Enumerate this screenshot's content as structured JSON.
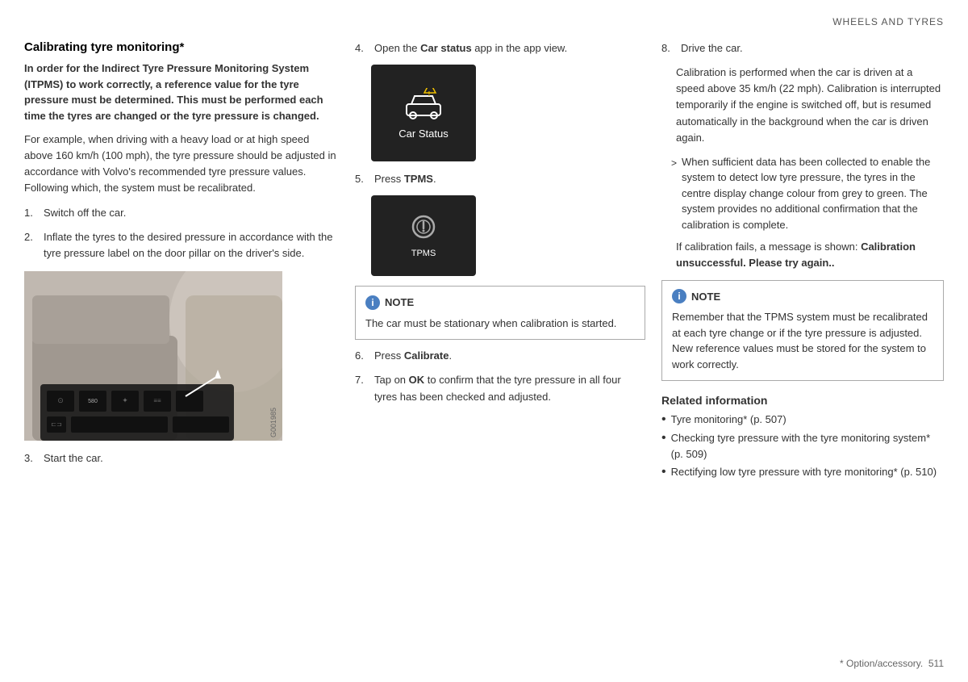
{
  "header": {
    "section_title": "WHEELS AND TYRES"
  },
  "left_col": {
    "title": "Calibrating tyre monitoring*",
    "intro_bold": "In order for the Indirect Tyre Pressure Monitoring System (ITPMS) to work correctly, a reference value for the tyre pressure must be determined. This must be performed each time the tyres are changed or the tyre pressure is changed.",
    "intro_normal": "For example, when driving with a heavy load or at high speed above 160 km/h (100 mph), the tyre pressure should be adjusted in accordance with Volvo's recommended tyre pressure values. Following which, the system must be recalibrated.",
    "step1_num": "1.",
    "step1_text": "Switch off the car.",
    "step2_num": "2.",
    "step2_text": "Inflate the tyres to the desired pressure in accordance with the tyre pressure label on the door pillar on the driver's side.",
    "step3_num": "3.",
    "step3_text": "Start the car.",
    "image_label": "G001985"
  },
  "mid_col": {
    "step4_num": "4.",
    "step4_text_pre": "Open the ",
    "step4_bold": "Car status",
    "step4_text_post": " app in the app view.",
    "app_label": "Car Status",
    "step5_num": "5.",
    "step5_text_pre": "Press ",
    "step5_bold": "TPMS",
    "step5_text_post": ".",
    "tpms_label": "TPMS",
    "note_title": "NOTE",
    "note_text": "The car must be stationary when calibration is started.",
    "step6_num": "6.",
    "step6_text_pre": "Press ",
    "step6_bold": "Calibrate",
    "step6_text_post": ".",
    "step7_num": "7.",
    "step7_text_pre": "Tap on ",
    "step7_bold": "OK",
    "step7_text_post": " to confirm that the tyre pressure in all four tyres has been checked and adjusted."
  },
  "right_col": {
    "step8_num": "8.",
    "step8_text": "Drive the car.",
    "step8_detail": "Calibration is performed when the car is driven at a speed above 35 km/h (22 mph). Calibration is interrupted temporarily if the engine is switched off, but is resumed automatically in the background when the car is driven again.",
    "bullet_intro": "When sufficient data has been collected to enable the system to detect low tyre pressure, the tyres in the centre display change colour from grey to green. The system provides no additional confirmation that the calibration is complete.",
    "calib_fail_pre": "If calibration fails, a message is shown: ",
    "calib_fail_bold": "Calibration unsuccessful. Please try again..",
    "note2_title": "NOTE",
    "note2_text": "Remember that the TPMS system must be recalibrated at each tyre change or if the tyre pressure is adjusted. New reference values must be stored for the system to work correctly.",
    "related_title": "Related information",
    "related_items": [
      "Tyre monitoring* (p. 507)",
      "Checking tyre pressure with the tyre monitoring system* (p. 509)",
      "Rectifying low tyre pressure with tyre monitoring* (p. 510)"
    ]
  },
  "footer": {
    "footnote": "* Option/accessory.",
    "page_num": "511"
  }
}
